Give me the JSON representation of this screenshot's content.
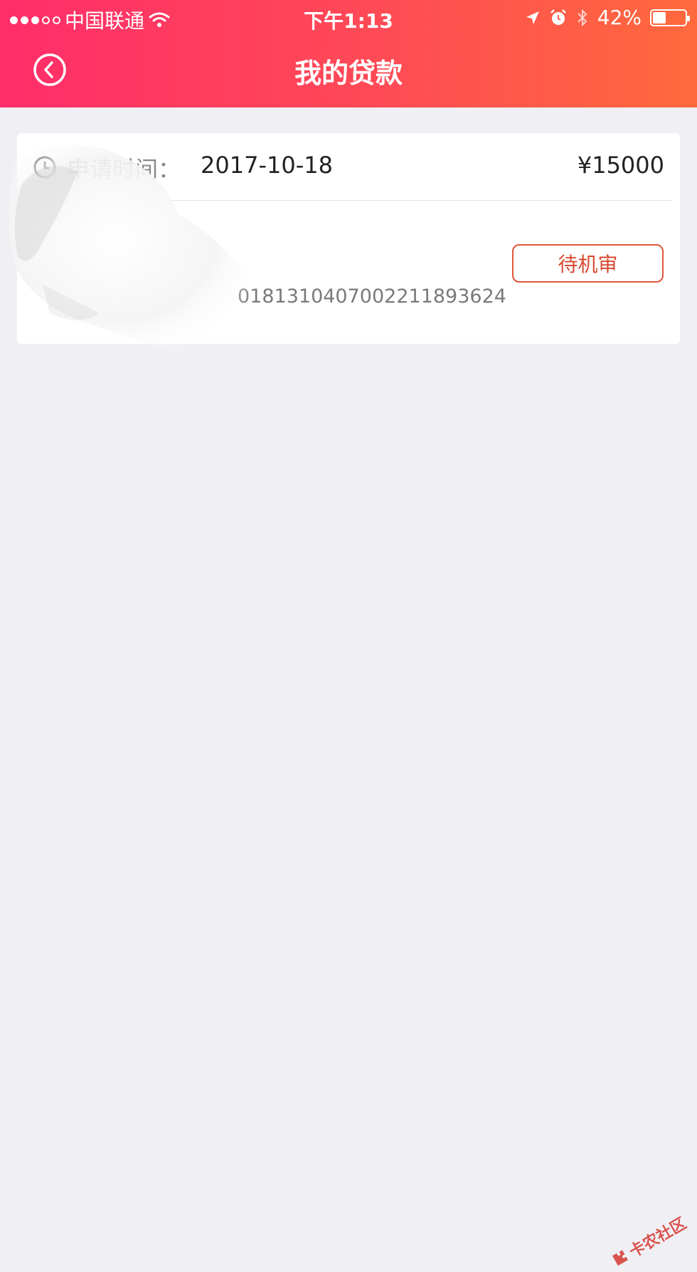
{
  "status_bar": {
    "carrier": "中国联通",
    "time": "下午1:13",
    "battery_percent": "42%",
    "signal_bars_filled": 3,
    "signal_bars_total": 5
  },
  "nav": {
    "title": "我的贷款",
    "back_icon": "back-circle-icon"
  },
  "loan": {
    "apply_label": "申请时间：",
    "apply_date": "2017-10-18",
    "amount": "¥15000",
    "status_label": "待机审",
    "order_number_visible": "0181310407002211893624"
  },
  "watermark": {
    "text": "卡农社区"
  },
  "colors": {
    "header_gradient_start": "#ff2d6a",
    "header_gradient_end": "#ff6a3d",
    "page_bg": "#efeff4",
    "status_accent": "#d84a30"
  }
}
